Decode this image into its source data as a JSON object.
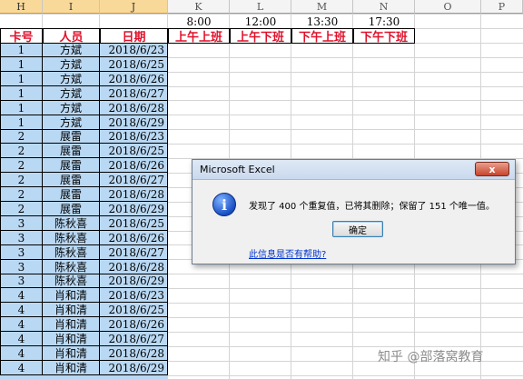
{
  "columns": [
    "H",
    "I",
    "J",
    "K",
    "L",
    "M",
    "N",
    "O",
    "P"
  ],
  "times": [
    "8:00",
    "12:00",
    "13:30",
    "17:30"
  ],
  "headers": [
    "卡号",
    "人员",
    "日期",
    "上午上班",
    "上午下班",
    "下午上班",
    "下午下班"
  ],
  "rows": [
    {
      "id": "1",
      "name": "方斌",
      "date": "2018/6/23"
    },
    {
      "id": "1",
      "name": "方斌",
      "date": "2018/6/25"
    },
    {
      "id": "1",
      "name": "方斌",
      "date": "2018/6/26"
    },
    {
      "id": "1",
      "name": "方斌",
      "date": "2018/6/27"
    },
    {
      "id": "1",
      "name": "方斌",
      "date": "2018/6/28"
    },
    {
      "id": "1",
      "name": "方斌",
      "date": "2018/6/29"
    },
    {
      "id": "2",
      "name": "展雷",
      "date": "2018/6/23"
    },
    {
      "id": "2",
      "name": "展雷",
      "date": "2018/6/25"
    },
    {
      "id": "2",
      "name": "展雷",
      "date": "2018/6/26"
    },
    {
      "id": "2",
      "name": "展雷",
      "date": "2018/6/27"
    },
    {
      "id": "2",
      "name": "展雷",
      "date": "2018/6/28"
    },
    {
      "id": "2",
      "name": "展雷",
      "date": "2018/6/29"
    },
    {
      "id": "3",
      "name": "陈秋喜",
      "date": "2018/6/25"
    },
    {
      "id": "3",
      "name": "陈秋喜",
      "date": "2018/6/26"
    },
    {
      "id": "3",
      "name": "陈秋喜",
      "date": "2018/6/27"
    },
    {
      "id": "3",
      "name": "陈秋喜",
      "date": "2018/6/28"
    },
    {
      "id": "3",
      "name": "陈秋喜",
      "date": "2018/6/29"
    },
    {
      "id": "4",
      "name": "肖和清",
      "date": "2018/6/23"
    },
    {
      "id": "4",
      "name": "肖和清",
      "date": "2018/6/25"
    },
    {
      "id": "4",
      "name": "肖和清",
      "date": "2018/6/26"
    },
    {
      "id": "4",
      "name": "肖和清",
      "date": "2018/6/27"
    },
    {
      "id": "4",
      "name": "肖和清",
      "date": "2018/6/28"
    },
    {
      "id": "4",
      "name": "肖和清",
      "date": "2018/6/29"
    }
  ],
  "dialog": {
    "title": "Microsoft Excel",
    "close_label": "x",
    "icon": "info-icon",
    "message": "发现了 400 个重复值，已将其删除；保留了 151 个唯一值。",
    "ok_label": "确定",
    "help_link": "此信息是否有帮助?"
  },
  "watermark": "知乎 @部落窝教育",
  "colors": {
    "selection_fill": "#b9d8f3",
    "header_red": "#e0102a",
    "selected_col_header": "#f9d99a"
  }
}
